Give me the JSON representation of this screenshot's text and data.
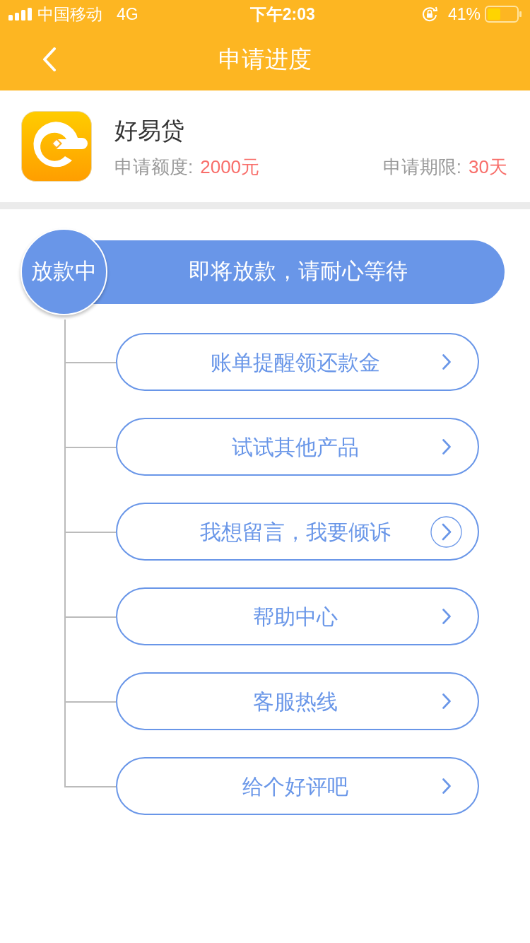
{
  "status_bar": {
    "carrier": "中国移动",
    "network": "4G",
    "time": "下午2:03",
    "battery": "41%"
  },
  "nav": {
    "title": "申请进度"
  },
  "loan": {
    "name": "好易贷",
    "amount_label": "申请额度:",
    "amount": "2000元",
    "term_label": "申请期限:",
    "term": "30天"
  },
  "progress": {
    "stage": "放款中",
    "message": "即将放款，请耐心等待"
  },
  "actions": [
    {
      "label": "账单提醒领还款金",
      "highlighted": false
    },
    {
      "label": "试试其他产品",
      "highlighted": false
    },
    {
      "label": "我想留言，我要倾诉",
      "highlighted": true
    },
    {
      "label": "帮助中心",
      "highlighted": false
    },
    {
      "label": "客服热线",
      "highlighted": false
    },
    {
      "label": "给个好评吧",
      "highlighted": false
    }
  ]
}
